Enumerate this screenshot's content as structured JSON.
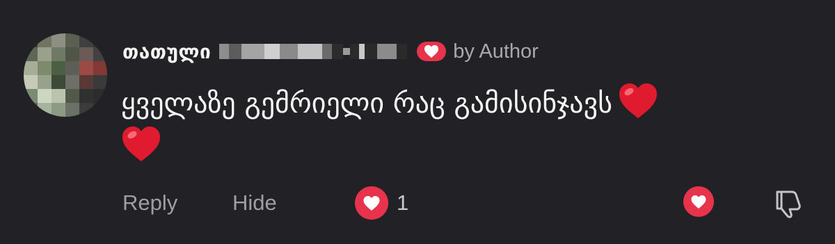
{
  "comment": {
    "username": "თათული",
    "author_label": "by Author",
    "text": "ყველაზე გემრიელი რაც გამისინჯავს",
    "heart_emoji": "❤️"
  },
  "actions": {
    "reply_label": "Reply",
    "hide_label": "Hide",
    "like_count": "1"
  },
  "colors": {
    "background": "#222226",
    "accent": "#e8334d",
    "muted_text": "#9e9ea3"
  },
  "icons": [
    "avatar-image",
    "heart-icon",
    "thumbs-down-icon"
  ]
}
